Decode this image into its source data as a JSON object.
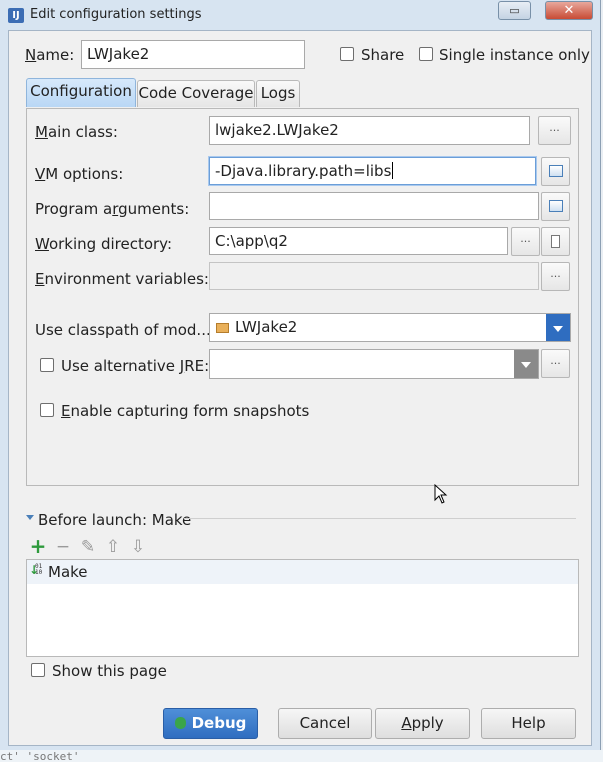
{
  "window": {
    "title": "Edit configuration settings",
    "app_icon_text": "IJ",
    "restore_glyph": "▭",
    "close_glyph": "✕"
  },
  "header": {
    "name_label": "Name:",
    "name_value": "LWJake2",
    "share_label": "Share",
    "share_checked": false,
    "single_instance_label": "Single instance only",
    "single_instance_checked": false
  },
  "tabs": [
    {
      "label": "Configuration",
      "active": true
    },
    {
      "label": "Code Coverage",
      "active": false
    },
    {
      "label": "Logs",
      "active": false
    }
  ],
  "config": {
    "main_class": {
      "label": "Main class:",
      "value": "lwjake2.LWJake2"
    },
    "vm_options": {
      "label": "VM options:",
      "value": "-Djava.library.path=libs"
    },
    "program_arguments": {
      "label": "Program arguments:",
      "value": ""
    },
    "working_directory": {
      "label": "Working directory:",
      "value": "C:\\app\\q2"
    },
    "environment_variables": {
      "label": "Environment variables:",
      "value": ""
    },
    "classpath_module": {
      "label": "Use classpath of mod...",
      "value": "LWJake2"
    },
    "alternative_jre": {
      "label": "Use alternative JRE:",
      "value": "",
      "checked": false
    },
    "capture_snapshots": {
      "label": "Enable capturing form snapshots",
      "checked": false
    },
    "ellipsis": "..."
  },
  "before_launch": {
    "title": "Before launch: Make",
    "toolbar": {
      "add": "+",
      "remove": "−",
      "edit": "✎",
      "up": "⇧",
      "down": "⇩"
    },
    "items": [
      {
        "icon_text": "01\n10",
        "label": "Make"
      }
    ]
  },
  "show_page": {
    "label": "Show this page",
    "checked": false
  },
  "buttons": {
    "debug": "Debug",
    "cancel": "Cancel",
    "apply": "Apply",
    "help": "Help"
  },
  "background_text": "ct' 'socket'",
  "colors": {
    "accent": "#2f6dc0",
    "add_green": "#2e9a3c",
    "tab_active": "#c4ddf7"
  }
}
